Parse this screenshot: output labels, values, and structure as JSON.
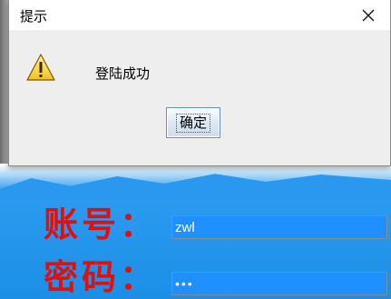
{
  "dialog": {
    "title": "提示",
    "message": "登陆成功",
    "ok_label": "确定",
    "icon": "warning-icon",
    "close_icon": "close-icon"
  },
  "login_form": {
    "account_label": "账号：",
    "account_value": "zwl",
    "password_label": "密码：",
    "password_value": "•••"
  },
  "colors": {
    "label_red": "#e01010",
    "field_blue": "#1e90ff",
    "background_blue": "#1e90e8",
    "dialog_bg": "#eeeeee"
  }
}
